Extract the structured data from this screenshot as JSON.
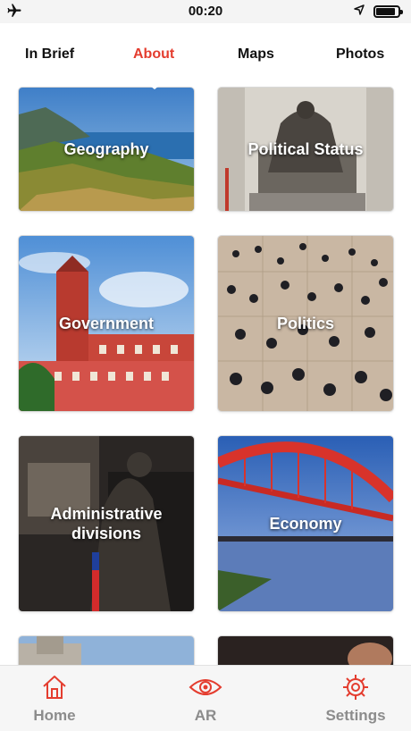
{
  "status_bar": {
    "time": "00:20",
    "icons": [
      "airplane-icon",
      "location-arrow-icon",
      "battery-icon"
    ],
    "battery_level": 0.8
  },
  "tabs": [
    {
      "label": "In Brief",
      "active": false
    },
    {
      "label": "About",
      "active": true
    },
    {
      "label": "Maps",
      "active": false
    },
    {
      "label": "Photos",
      "active": false
    }
  ],
  "cards": [
    {
      "label": "Geography",
      "image": "coastal-hills-photo"
    },
    {
      "label": "Political Status",
      "image": "memorial-statue-photo"
    },
    {
      "label": "Government",
      "image": "presidential-building-photo"
    },
    {
      "label": "Politics",
      "image": "crowd-square-photo"
    },
    {
      "label": "Administrative divisions",
      "image": "statue-hall-photo"
    },
    {
      "label": "Economy",
      "image": "red-arch-bridge-photo"
    },
    {
      "label": "",
      "image": "building-photo"
    },
    {
      "label": "",
      "image": "dark-photo"
    }
  ],
  "bottom_nav": [
    {
      "label": "Home",
      "icon": "home-icon"
    },
    {
      "label": "AR",
      "icon": "eye-icon"
    },
    {
      "label": "Settings",
      "icon": "gear-icon"
    }
  ],
  "colors": {
    "accent": "#e43d2f",
    "nav_text": "#8c8c8c"
  }
}
